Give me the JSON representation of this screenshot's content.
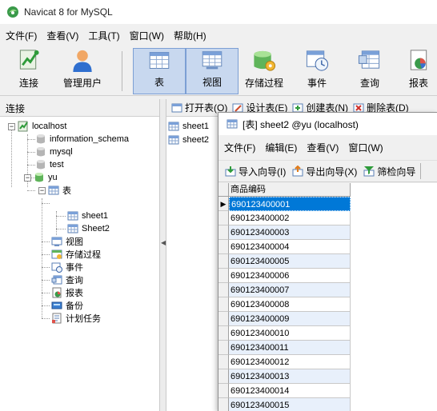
{
  "window": {
    "title": "Navicat 8 for MySQL"
  },
  "menu": [
    "文件(F)",
    "查看(V)",
    "工具(T)",
    "窗口(W)",
    "帮助(H)"
  ],
  "toolbar": {
    "connect": "连接",
    "users": "管理用户",
    "tables": "表",
    "views": "视图",
    "procedures": "存储过程",
    "events": "事件",
    "queries": "查询",
    "reports": "报表"
  },
  "left_panel": {
    "header": "连接",
    "tree": {
      "server": "localhost",
      "databases": [
        "information_schema",
        "mysql",
        "test",
        "yu"
      ],
      "yu_children": {
        "tables": "表",
        "tables_items": [
          "sheet1",
          "Sheet2"
        ],
        "others": [
          "视图",
          "存储过程",
          "事件",
          "查询",
          "报表",
          "备份",
          "计划任务"
        ]
      }
    }
  },
  "object_toolbar": [
    "打开表(O)",
    "设计表(E)",
    "创建表(N)",
    "删除表(D)"
  ],
  "object_list": [
    "sheet1",
    "sheet2"
  ],
  "data_window": {
    "title": "[表] sheet2 @yu (localhost)",
    "menu": [
      "文件(F)",
      "编辑(E)",
      "查看(V)",
      "窗口(W)"
    ],
    "tools": [
      "导入向导(I)",
      "导出向导(X)",
      "筛检向导"
    ],
    "column": "商品编码",
    "rows": [
      "690123400001",
      "690123400002",
      "690123400003",
      "690123400004",
      "690123400005",
      "690123400006",
      "690123400007",
      "690123400008",
      "690123400009",
      "690123400010",
      "690123400011",
      "690123400012",
      "690123400013",
      "690123400014",
      "690123400015"
    ]
  },
  "colors": {
    "selection": "#0078d7",
    "active_button": "#c8d8ef",
    "alt_row": "#e8f0fb"
  }
}
